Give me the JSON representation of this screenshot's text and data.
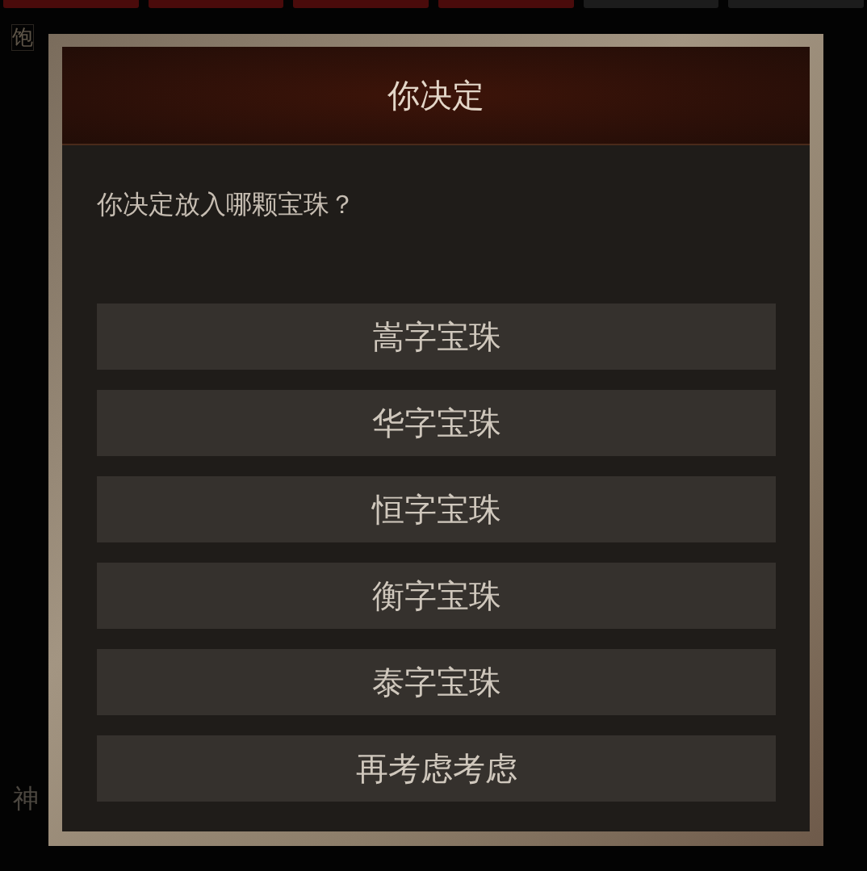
{
  "background": {
    "tabs": [
      {
        "color": "#4a0b0b"
      },
      {
        "color": "#4a0b0b"
      },
      {
        "color": "#4a0b0b"
      },
      {
        "color": "#4a0b0b"
      },
      {
        "color": "#1c1c1c"
      },
      {
        "color": "#1c1c1c"
      }
    ],
    "side_label": "饱",
    "bottom_label": "神"
  },
  "dialog": {
    "title": "你决定",
    "question": "你决定放入哪颗宝珠？",
    "options": [
      "嵩字宝珠",
      "华字宝珠",
      "恒字宝珠",
      "衡字宝珠",
      "泰字宝珠",
      "再考虑考虑"
    ]
  }
}
